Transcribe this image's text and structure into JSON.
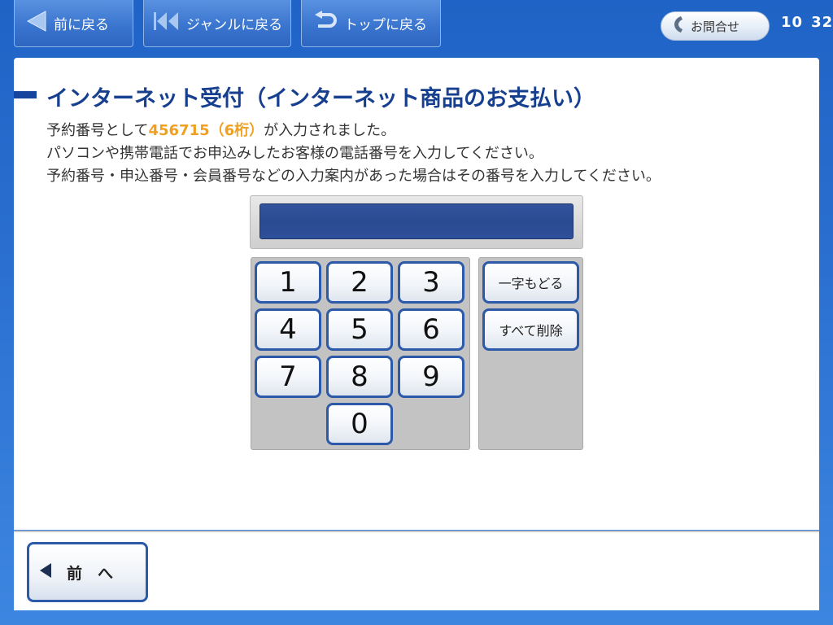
{
  "topbar": {
    "back_label": "前に戻る",
    "genre_label": "ジャンルに戻る",
    "top_label": "トップに戻る",
    "contact_label": "お問合せ",
    "clock": {
      "hour": "10",
      "minute": "32"
    }
  },
  "main": {
    "title": "インターネット受付（インターネット商品のお支払い）",
    "message_line1_prefix": "予約番号として",
    "message_line1_value": "456715（6桁）",
    "message_line1_suffix": "が入力されました。",
    "message_line2": "パソコンや携帯電話でお申込みしたお客様の電話番号を入力してください。",
    "message_line3": "予約番号・申込番号・会員番号などの入力案内があった場合はその番号を入力してください。",
    "input_value": "",
    "keypad": {
      "keys": [
        "1",
        "2",
        "3",
        "4",
        "5",
        "6",
        "7",
        "8",
        "9",
        "0"
      ],
      "backspace_label": "一字もどる",
      "clear_label": "すべて削除"
    }
  },
  "footer": {
    "prev_label": "前　へ"
  },
  "colors": {
    "accent": "#173f8f",
    "highlight": "#f0a020",
    "key_border": "#2d5aa8",
    "display": "#2a4a91"
  },
  "icons": {
    "back": "triangle-left-icon",
    "genre": "skip-back-icon",
    "top": "return-arrow-icon",
    "contact": "phone-icon",
    "prev": "triangle-left-icon"
  }
}
